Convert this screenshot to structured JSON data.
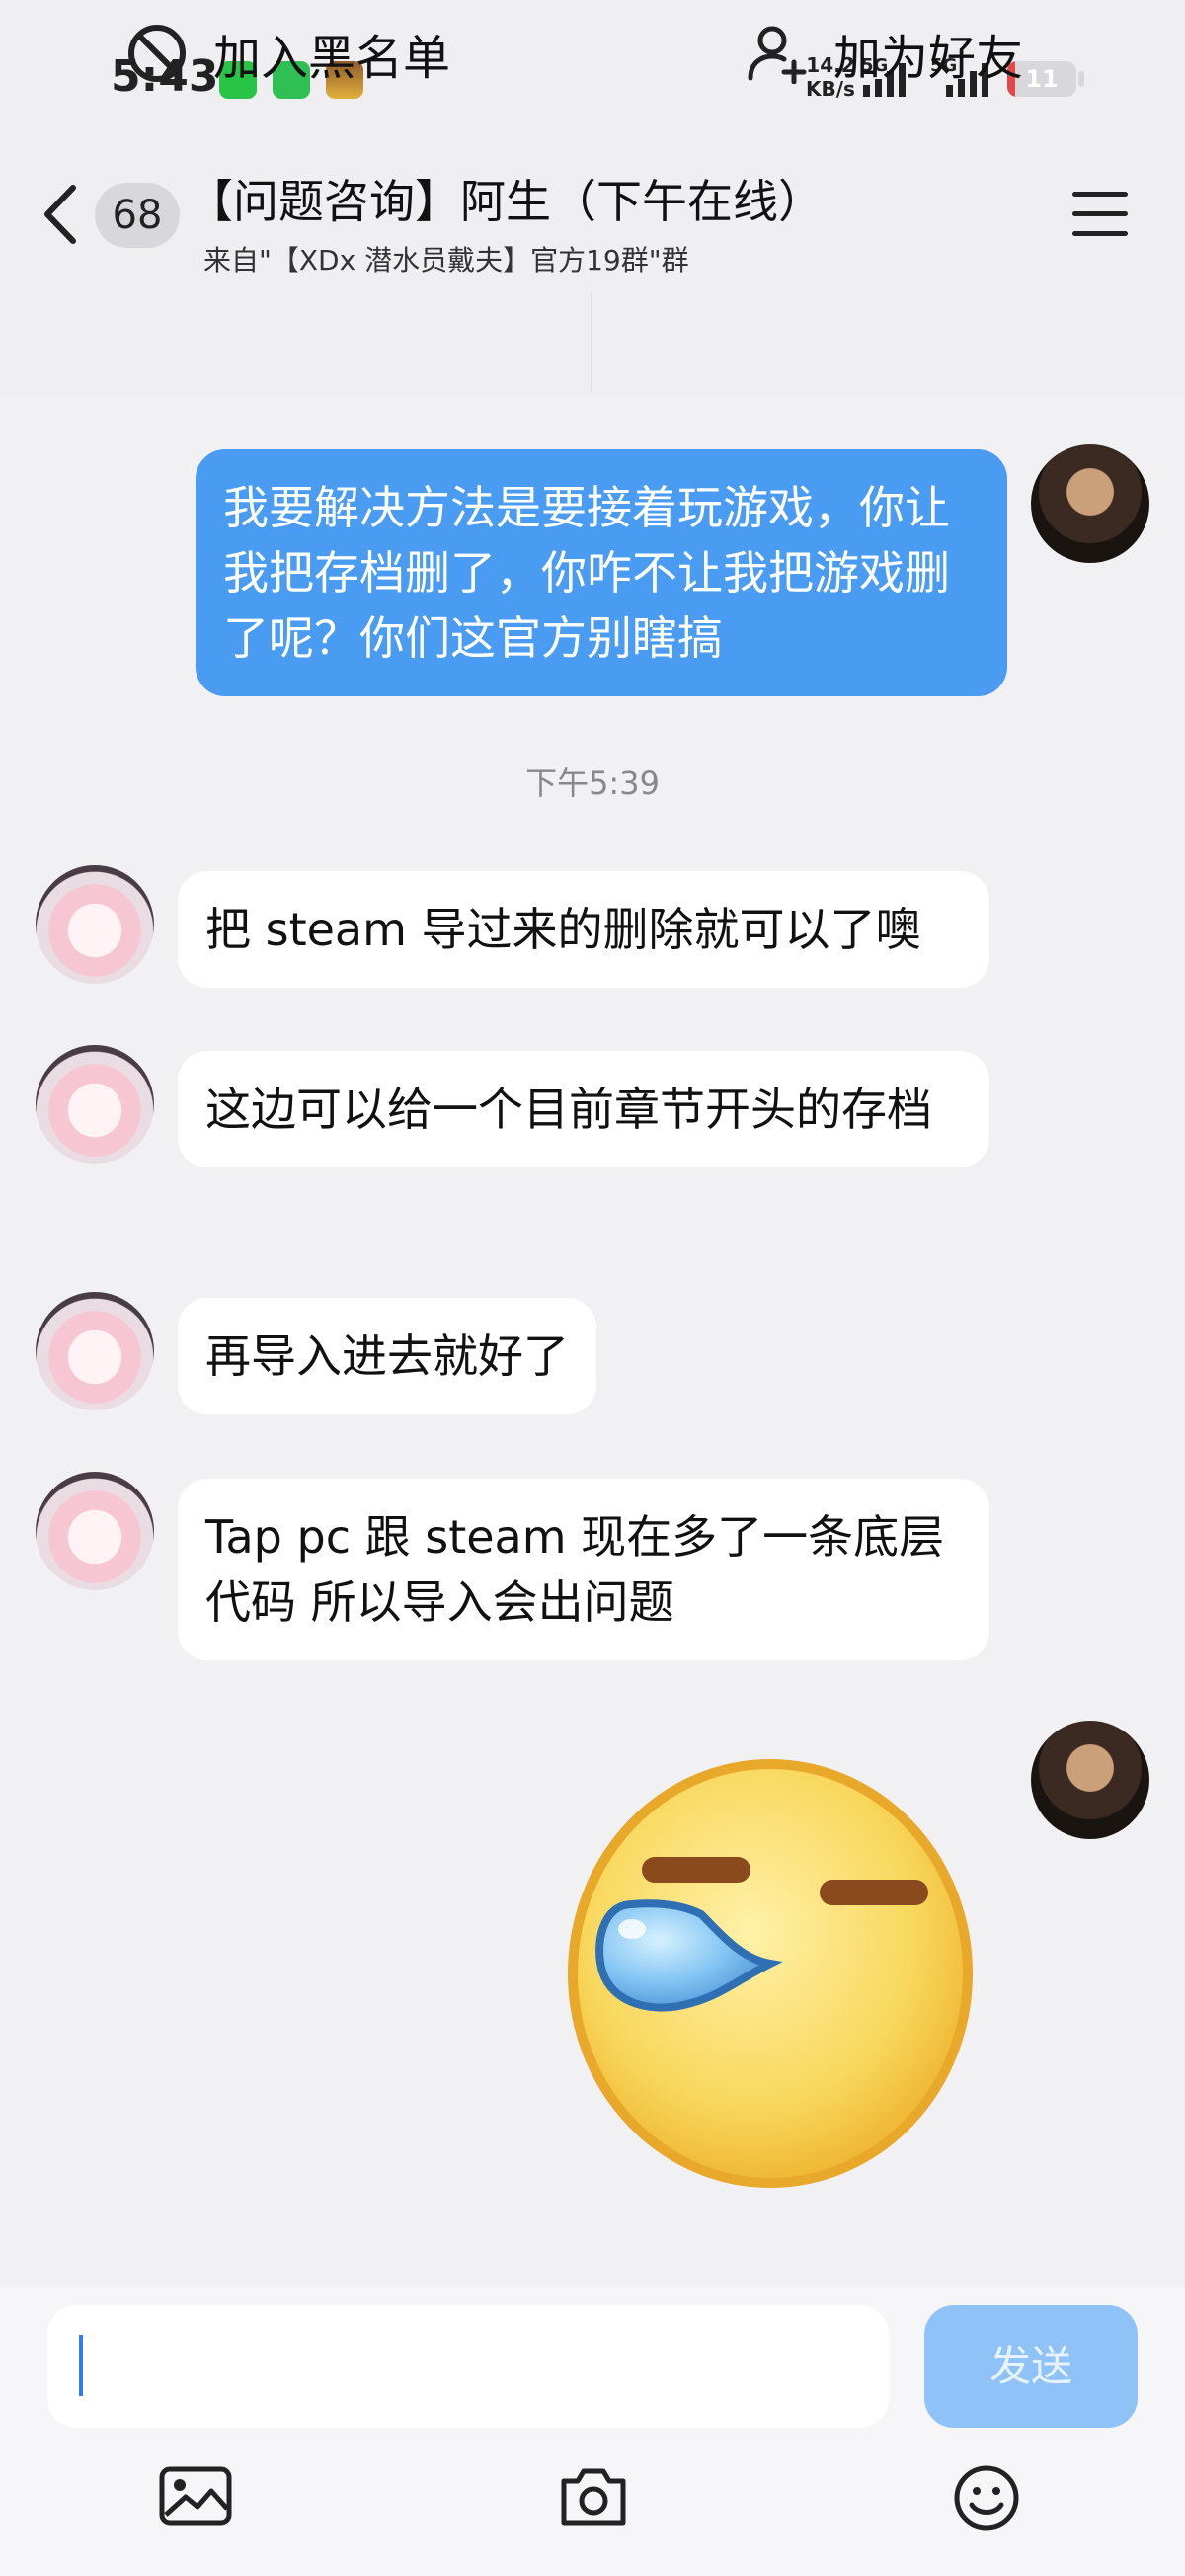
{
  "status_bar": {
    "time": "5:43",
    "net_speed_value": "14.2",
    "net_speed_unit": "KB/s",
    "signal_1_label": "5G",
    "signal_2_label": "5G",
    "battery": "11",
    "battery_level": 0.11,
    "battery_color": "#e24848"
  },
  "header": {
    "unread_count": "68",
    "title": "【问题咨询】阿生（下午在线）",
    "subtitle": "来自\"【XDx 潜水员戴夫】官方19群\"群"
  },
  "actions": {
    "blacklist_label": "加入黑名单",
    "add_friend_label": "加为好友"
  },
  "chat": {
    "accent_color": "#4a9bf2",
    "messages": [
      {
        "from": "me",
        "text": "我要解决方法是要接着玩游戏，你让我把存档删了，你咋不让我把游戏删了呢？你们这官方别瞎搞"
      },
      {
        "from": "them",
        "text": "把 steam 导过来的删除就可以了噢"
      },
      {
        "from": "them",
        "text": "这边可以给一个目前章节开头的存档"
      },
      {
        "from": "them",
        "text": "再导入进去就好了"
      },
      {
        "from": "them",
        "text": "Tap pc 跟 steam 现在多了一条底层代码 所以导入会出问题"
      }
    ],
    "timestamp": "下午5:39",
    "sticker": "sweat-emoji"
  },
  "input": {
    "placeholder": "",
    "send_label": "发送"
  },
  "icons": [
    "back-icon",
    "menu-icon",
    "block-icon",
    "add-friend-icon",
    "image-icon",
    "camera-icon",
    "emoji-icon"
  ]
}
